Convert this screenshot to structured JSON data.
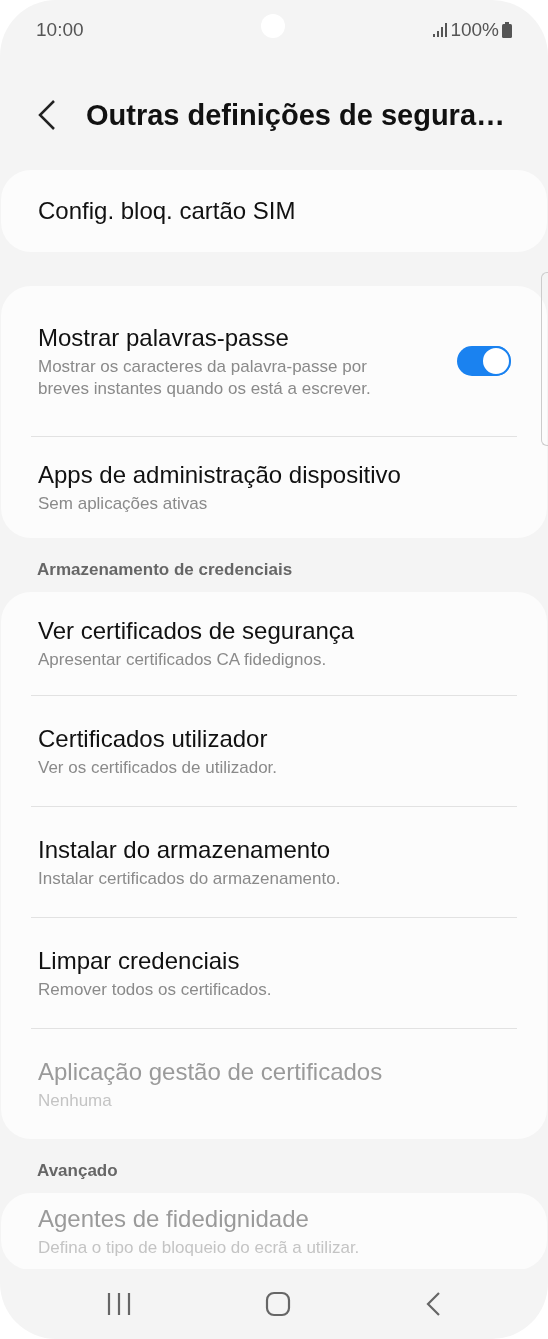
{
  "status_bar": {
    "time": "10:00",
    "battery": "100%"
  },
  "header": {
    "title": "Outras definições de segura…"
  },
  "sections": [
    {
      "items": [
        {
          "title": "Config. bloq. cartão SIM",
          "disabled": false
        }
      ]
    },
    {
      "items": [
        {
          "title": "Mostrar palavras-passe",
          "subtitle": "Mostrar os caracteres da palavra-passe por breves instantes quando os está a escrever.",
          "disabled": false,
          "kind": "toggle",
          "on": true
        },
        {
          "title": "Apps de administração dispositivo",
          "subtitle": "Sem aplicações ativas",
          "disabled": false
        }
      ]
    },
    {
      "label": "Armazenamento de credenciais",
      "items": [
        {
          "title": "Ver certificados de segurança",
          "subtitle": "Apresentar certificados CA fidedignos.",
          "disabled": false
        },
        {
          "title": "Certificados utilizador",
          "subtitle": "Ver os certificados de utilizador.",
          "disabled": false
        },
        {
          "title": "Instalar do armazenamento",
          "subtitle": "Instalar certificados do armazenamento.",
          "disabled": false
        },
        {
          "title": "Limpar credenciais",
          "subtitle": "Remover todos os certificados.",
          "disabled": false
        },
        {
          "title": "Aplicação gestão de certificados",
          "subtitle": "Nenhuma",
          "disabled": true
        }
      ]
    },
    {
      "label": "Avançado",
      "items": [
        {
          "title": "Agentes de fidedignidade",
          "subtitle": "Defina o tipo de bloqueio do ecrã a utilizar.",
          "disabled": true
        }
      ]
    }
  ]
}
